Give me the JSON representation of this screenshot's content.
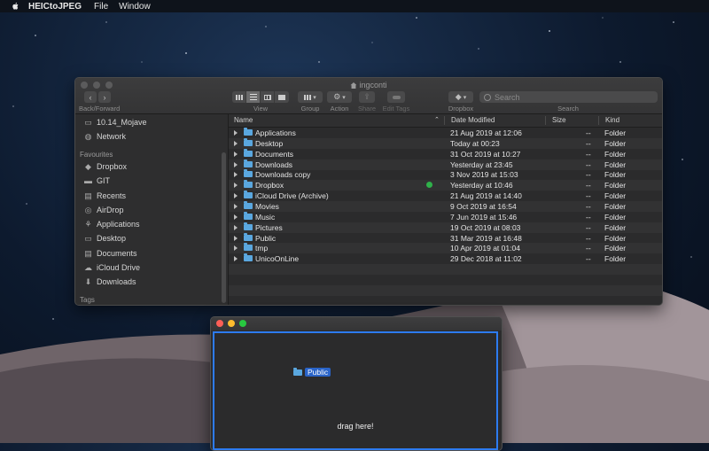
{
  "menubar": {
    "app_name": "HEICtoJPEG",
    "menus": [
      "File",
      "Window"
    ]
  },
  "finder": {
    "title": "ingconti",
    "toolbar": {
      "back_forward_label": "Back/Forward",
      "view_label": "View",
      "group_label": "Group",
      "action_label": "Action",
      "share_label": "Share",
      "edit_tags_label": "Edit Tags",
      "dropbox_label": "Dropbox",
      "search_label": "Search",
      "search_placeholder": "Search"
    },
    "sidebar": {
      "top_items": [
        {
          "label": "10.14_Mojave",
          "icon": "disk-icon"
        },
        {
          "label": "Network",
          "icon": "globe-icon"
        }
      ],
      "favourites_header": "Favourites",
      "favourites": [
        {
          "label": "Dropbox",
          "icon": "dropbox-icon"
        },
        {
          "label": "GIT",
          "icon": "folder-icon"
        },
        {
          "label": "Recents",
          "icon": "clock-icon"
        },
        {
          "label": "AirDrop",
          "icon": "airdrop-icon"
        },
        {
          "label": "Applications",
          "icon": "applications-icon"
        },
        {
          "label": "Desktop",
          "icon": "desktop-icon"
        },
        {
          "label": "Documents",
          "icon": "document-icon"
        },
        {
          "label": "iCloud Drive",
          "icon": "cloud-icon"
        },
        {
          "label": "Downloads",
          "icon": "download-icon"
        }
      ],
      "tags_header": "Tags"
    },
    "columns": {
      "name": "Name",
      "date": "Date Modified",
      "size": "Size",
      "kind": "Kind"
    },
    "rows": [
      {
        "name": "Applications",
        "date": "21 Aug 2019 at 12:06",
        "size": "--",
        "kind": "Folder"
      },
      {
        "name": "Desktop",
        "date": "Today at 00:23",
        "size": "--",
        "kind": "Folder"
      },
      {
        "name": "Documents",
        "date": "31 Oct 2019 at 10:27",
        "size": "--",
        "kind": "Folder"
      },
      {
        "name": "Downloads",
        "date": "Yesterday at 23:45",
        "size": "--",
        "kind": "Folder"
      },
      {
        "name": "Downloads copy",
        "date": "3 Nov 2019 at 15:03",
        "size": "--",
        "kind": "Folder"
      },
      {
        "name": "Dropbox",
        "date": "Yesterday at 10:46",
        "size": "--",
        "kind": "Folder",
        "synced": true
      },
      {
        "name": "iCloud Drive (Archive)",
        "date": "21 Aug 2019 at 14:40",
        "size": "--",
        "kind": "Folder"
      },
      {
        "name": "Movies",
        "date": "9 Oct 2019 at 16:54",
        "size": "--",
        "kind": "Folder"
      },
      {
        "name": "Music",
        "date": "7 Jun 2019 at 15:46",
        "size": "--",
        "kind": "Folder"
      },
      {
        "name": "Pictures",
        "date": "19 Oct 2019 at 08:03",
        "size": "--",
        "kind": "Folder"
      },
      {
        "name": "Public",
        "date": "31 Mar 2019 at 16:48",
        "size": "--",
        "kind": "Folder"
      },
      {
        "name": "tmp",
        "date": "10 Apr 2019 at 01:04",
        "size": "--",
        "kind": "Folder"
      },
      {
        "name": "UnicoOnLine",
        "date": "29 Dec 2018 at 11:02",
        "size": "--",
        "kind": "Folder"
      }
    ]
  },
  "drop_window": {
    "dragged_item": "Public",
    "hint": "drag here!"
  },
  "colors": {
    "accent_blue": "#2d7bf0",
    "folder_blue": "#5aa7df",
    "synced_green": "#2fb14a"
  }
}
